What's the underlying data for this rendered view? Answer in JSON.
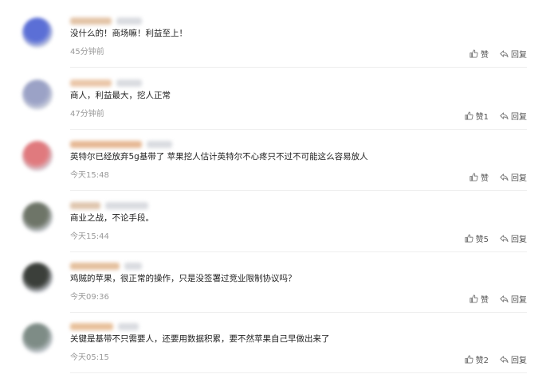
{
  "comments": [
    {
      "text": "没什么的！商场嘛！利益至上！",
      "time": "45分钟前",
      "like_label": "赞",
      "reply_label": "回复",
      "avatar_color": "#5b6fd6",
      "name_color": "#e3c3a6"
    },
    {
      "text": "商人，利益最大，挖人正常",
      "time": "47分钟前",
      "like_label": "赞1",
      "reply_label": "回复",
      "avatar_color": "#9ba2c6",
      "name_color": "#eac6a8"
    },
    {
      "text": "英特尔已经放弃5g基带了 苹果挖人估计英特尔不心疼只不过不可能这么容易放人",
      "time": "今天15:48",
      "like_label": "赞",
      "reply_label": "回复",
      "avatar_color": "#e07a7e",
      "name_color": "#e6b894"
    },
    {
      "text": "商业之战，不论手段。",
      "time": "今天15:44",
      "like_label": "赞5",
      "reply_label": "回复",
      "avatar_color": "#6e7568",
      "name_color": "#dfc6ae"
    },
    {
      "text": "鸡贼的苹果，很正常的操作，只是没签署过竞业限制协议吗？",
      "time": "今天09:36",
      "like_label": "赞",
      "reply_label": "回复",
      "avatar_color": "#3b3f3a",
      "name_color": "#e4bf9d"
    },
    {
      "text": "关键是基带不只需要人，还要用数据积累，要不然苹果自己早做出来了",
      "time": "今天05:15",
      "like_label": "赞2",
      "reply_label": "回复",
      "avatar_color": "#7e8c86",
      "name_color": "#e8c09a"
    }
  ]
}
